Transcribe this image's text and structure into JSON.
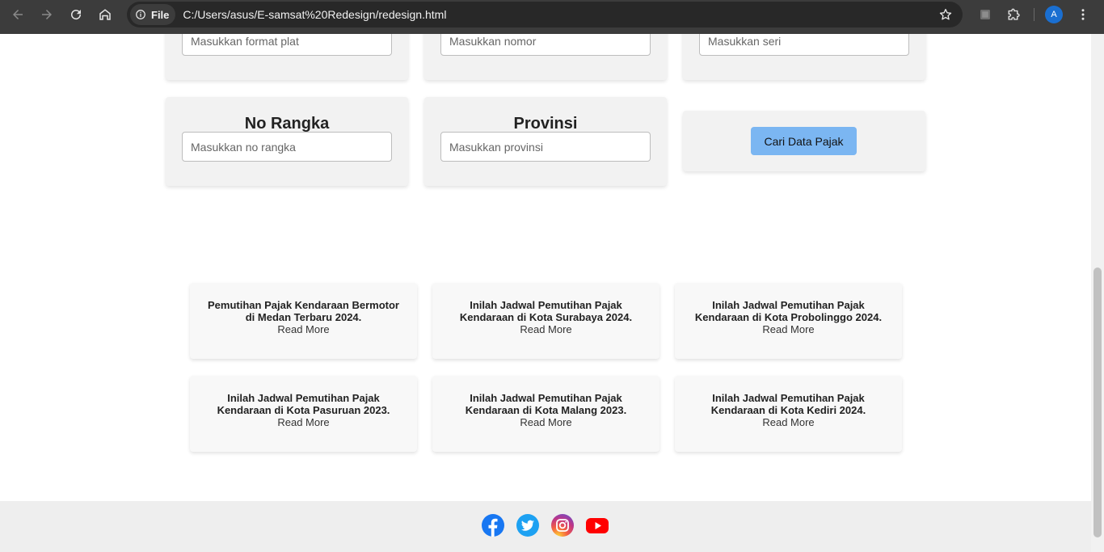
{
  "browser": {
    "site_chip": "File",
    "url": "C:/Users/asus/E-samsat%20Redesign/redesign.html",
    "avatar_letter": "A"
  },
  "form": {
    "row1": [
      {
        "placeholder": "Masukkan format plat"
      },
      {
        "placeholder": "Masukkan nomor"
      },
      {
        "placeholder": "Masukkan seri"
      }
    ],
    "no_rangka": {
      "label": "No Rangka",
      "placeholder": "Masukkan no rangka"
    },
    "provinsi": {
      "label": "Provinsi",
      "placeholder": "Masukkan provinsi"
    },
    "search_button": "Cari Data Pajak"
  },
  "news": [
    {
      "title": "Pemutihan Pajak Kendaraan Bermotor di Medan Terbaru 2024.",
      "link": "Read More"
    },
    {
      "title": "Inilah Jadwal Pemutihan Pajak Kendaraan di Kota Surabaya 2024.",
      "link": "Read More"
    },
    {
      "title": "Inilah Jadwal Pemutihan Pajak Kendaraan di Kota Probolinggo 2024.",
      "link": "Read More"
    },
    {
      "title": "Inilah Jadwal Pemutihan Pajak Kendaraan di Kota Pasuruan 2023.",
      "link": "Read More"
    },
    {
      "title": "Inilah Jadwal Pemutihan Pajak Kendaraan di Kota Malang 2023.",
      "link": "Read More"
    },
    {
      "title": "Inilah Jadwal Pemutihan Pajak Kendaraan di Kota Kediri 2024.",
      "link": "Read More"
    }
  ],
  "footer": {
    "social_icons": [
      "facebook-icon",
      "twitter-icon",
      "instagram-icon",
      "youtube-icon"
    ]
  },
  "colors": {
    "button": "#7bb6f2",
    "facebook": "#1877f2",
    "twitter": "#1da1f2",
    "youtube": "#ff0000"
  }
}
